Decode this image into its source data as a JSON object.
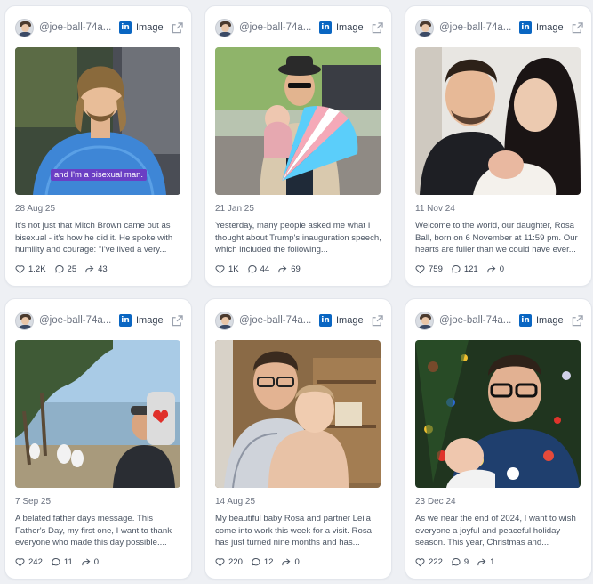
{
  "colors": {
    "linkedin_blue": "#0a66c2",
    "card_bg": "#ffffff",
    "page_bg": "#eef0f4"
  },
  "posts": [
    {
      "handle": "@joe-ball-74a...",
      "media_label": "Image",
      "date": "28 Aug 25",
      "caption": "It's not just that Mitch Brown came out as bisexual - it's how he did it. He spoke with humility and courage: \"I've lived a very...",
      "photo_caption": "and I'm a bisexual man.",
      "likes": "1.2K",
      "comments": "25",
      "reposts": "43"
    },
    {
      "handle": "@joe-ball-74a...",
      "media_label": "Image",
      "date": "21 Jan 25",
      "caption": "Yesterday, many people asked me what I thought about Trump's inauguration speech, which included the following...",
      "likes": "1K",
      "comments": "44",
      "reposts": "69"
    },
    {
      "handle": "@joe-ball-74a...",
      "media_label": "Image",
      "date": "11 Nov 24",
      "caption": "Welcome to the world, our daughter, Rosa Ball, born on 6 November at 11:59 pm. Our hearts are fuller than we could have ever...",
      "likes": "759",
      "comments": "121",
      "reposts": "0"
    },
    {
      "handle": "@joe-ball-74a...",
      "media_label": "Image",
      "date": "7 Sep 25",
      "caption": "A belated father days message. This Father's Day, my first one, I want to thank everyone who made this day possible....",
      "likes": "242",
      "comments": "11",
      "reposts": "0"
    },
    {
      "handle": "@joe-ball-74a...",
      "media_label": "Image",
      "date": "14 Aug 25",
      "caption": "My beautiful baby Rosa and partner Leila come into work this week for a visit. Rosa has just turned nine months and has...",
      "likes": "220",
      "comments": "12",
      "reposts": "0"
    },
    {
      "handle": "@joe-ball-74a...",
      "media_label": "Image",
      "date": "23 Dec 24",
      "caption": "As we near the end of 2024, I want to wish everyone a joyful and peaceful holiday season. This year, Christmas and...",
      "likes": "222",
      "comments": "9",
      "reposts": "1"
    }
  ]
}
